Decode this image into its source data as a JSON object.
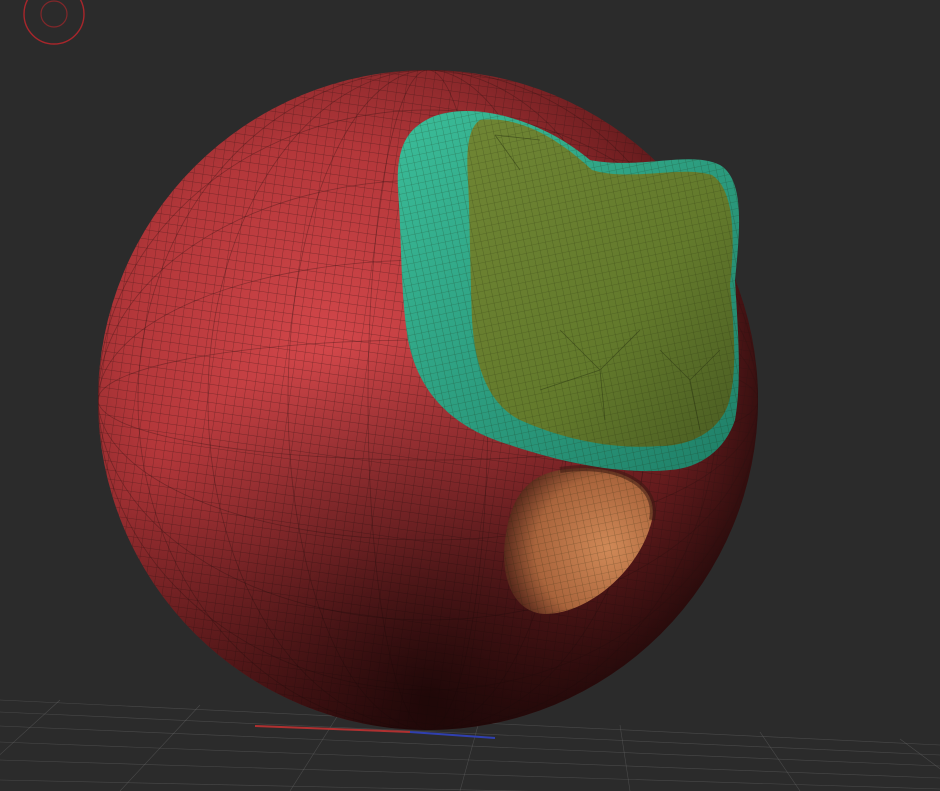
{
  "viewport": {
    "background_color": "#2b2b2b",
    "floor_grid_color": "#6f6f6f",
    "axis_x_color": "#b03030",
    "axis_z_color": "#3040b0"
  },
  "gizmo": {
    "icon": "orientation-gizmo-icon",
    "color": "#a8262b"
  },
  "model": {
    "sphere_color": "#c0393b",
    "wire_color": "#2a1010",
    "masked_region_inner_color": "#6a7b2e",
    "masked_region_edge_color": "#2fa98a",
    "dent_color": "#c27a4c"
  }
}
